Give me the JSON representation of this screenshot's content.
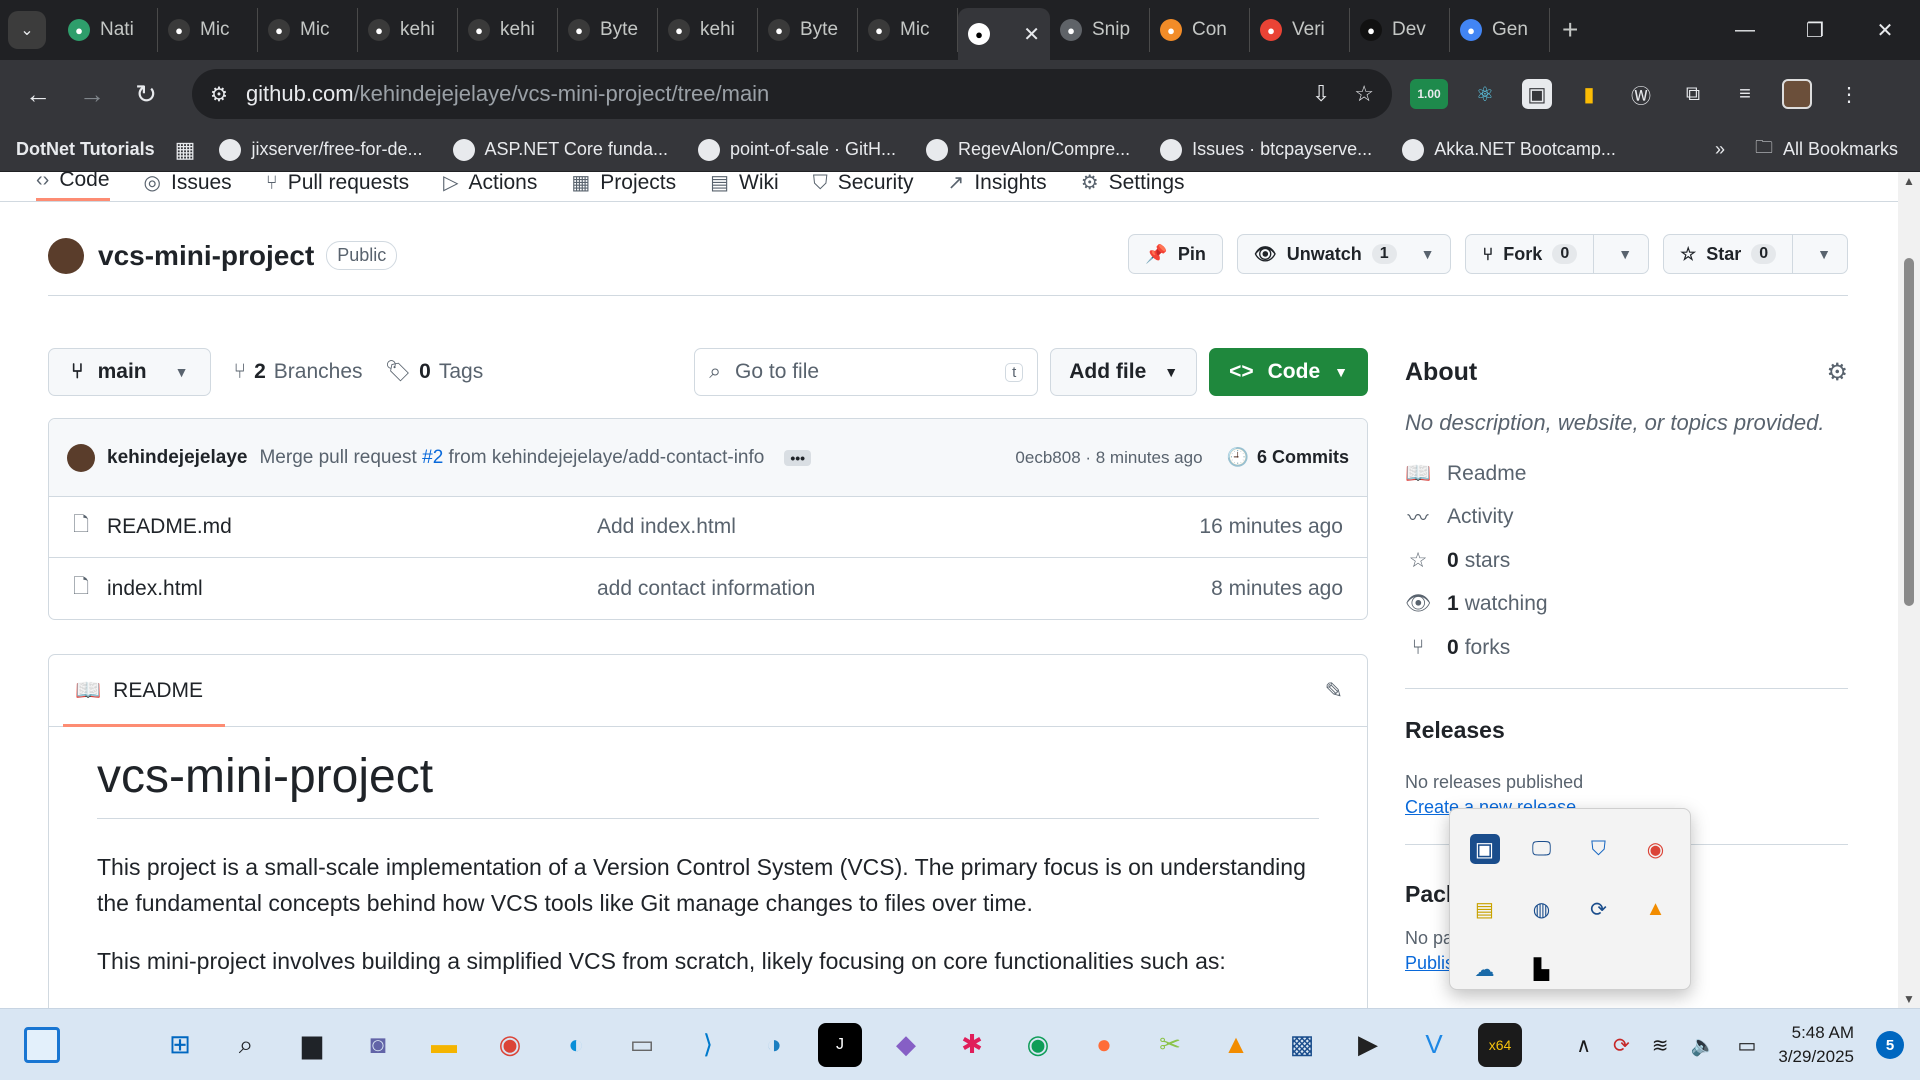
{
  "browser": {
    "tabs": [
      {
        "label": "Nati",
        "icon": "notion-green-icon",
        "color": "#2e9e6b"
      },
      {
        "label": "Mic",
        "icon": "github-icon",
        "color": "#3a3a3a"
      },
      {
        "label": "Mic",
        "icon": "github-icon",
        "color": "#3a3a3a"
      },
      {
        "label": "kehi",
        "icon": "github-icon",
        "color": "#3a3a3a"
      },
      {
        "label": "kehi",
        "icon": "github-icon",
        "color": "#3a3a3a"
      },
      {
        "label": "Byte",
        "icon": "github-icon",
        "color": "#3a3a3a"
      },
      {
        "label": "kehi",
        "icon": "github-icon",
        "color": "#3a3a3a"
      },
      {
        "label": "Byte",
        "icon": "github-icon",
        "color": "#3a3a3a"
      },
      {
        "label": "Mic",
        "icon": "github-icon",
        "color": "#3a3a3a"
      }
    ],
    "active_tab": {
      "icon": "github-icon",
      "close": "✕"
    },
    "tabs_right": [
      {
        "label": "Snip",
        "icon": "globe-icon",
        "color": "#5f6368"
      },
      {
        "label": "Con",
        "icon": "box-orange-icon",
        "color": "#f28c28"
      },
      {
        "label": "Veri",
        "icon": "gmail-icon",
        "color": "#ea4335"
      },
      {
        "label": "Dev",
        "icon": "openai-icon",
        "color": "#111111"
      },
      {
        "label": "Gen",
        "icon": "gemini-star-icon",
        "color": "#4285f4"
      }
    ],
    "url_host": "github.com",
    "url_path": "/kehindejejelaye/vcs-mini-project/tree/main",
    "extension_badge": "1.00",
    "bookmarks": [
      {
        "label": "DotNet Tutorials",
        "bold": true
      },
      {
        "label": "jixserver/free-for-de..."
      },
      {
        "label": "ASP.NET Core funda..."
      },
      {
        "label": "point-of-sale · GitH..."
      },
      {
        "label": "RegevAlon/Compre..."
      },
      {
        "label": "Issues · btcpayserve..."
      },
      {
        "label": "Akka.NET Bootcamp..."
      }
    ],
    "bookmarks_more": "»",
    "all_bookmarks": "All Bookmarks"
  },
  "repo_nav": [
    "Code",
    "Issues",
    "Pull requests",
    "Actions",
    "Projects",
    "Wiki",
    "Security",
    "Insights",
    "Settings"
  ],
  "repo": {
    "name": "vcs-mini-project",
    "visibility": "Public",
    "pin": "Pin",
    "unwatch": "Unwatch",
    "watch_count": "1",
    "fork": "Fork",
    "fork_count": "0",
    "star": "Star",
    "star_count": "0"
  },
  "filebar": {
    "branch": "main",
    "branches_count": "2",
    "branches_label": "Branches",
    "tags_count": "0",
    "tags_label": "Tags",
    "goto_placeholder": "Go to file",
    "goto_kbd": "t",
    "add_file": "Add file",
    "code": "Code"
  },
  "commit": {
    "author": "kehindejejelaye",
    "message_pre": "Merge pull request ",
    "pr": "#2",
    "message_post": " from kehindejejelaye/add-contact-info",
    "sha_time": "0ecb808 · 8 minutes ago",
    "commits": "6 Commits"
  },
  "files": [
    {
      "name": "README.md",
      "commit": "Add index.html",
      "age": "16 minutes ago"
    },
    {
      "name": "index.html",
      "commit": "add contact information",
      "age": "8 minutes ago"
    }
  ],
  "readme": {
    "tab": "README",
    "title": "vcs-mini-project",
    "p1": "This project is a small-scale implementation of a Version Control System (VCS). The primary focus is on understanding the fundamental concepts behind how VCS tools like Git manage changes to files over time.",
    "p2": "This mini-project involves building a simplified VCS from scratch, likely focusing on core functionalities such as:"
  },
  "about": {
    "title": "About",
    "description": "No description, website, or topics provided.",
    "items": [
      {
        "icon": "book-icon",
        "count": "",
        "label": "Readme"
      },
      {
        "icon": "pulse-icon",
        "count": "",
        "label": "Activity"
      },
      {
        "icon": "star-icon",
        "count": "0",
        "label": "stars"
      },
      {
        "icon": "eye-icon",
        "count": "1",
        "label": "watching"
      },
      {
        "icon": "fork-icon",
        "count": "0",
        "label": "forks"
      }
    ],
    "releases_title": "Releases",
    "releases_none": "No releases published",
    "releases_link": "Create a new release",
    "packages_title": "Packages",
    "packages_none": "No packages published",
    "packages_link": "Publish your first package"
  },
  "taskbar": {
    "time": "5:48 AM",
    "date": "3/29/2025",
    "notifications": "5"
  }
}
